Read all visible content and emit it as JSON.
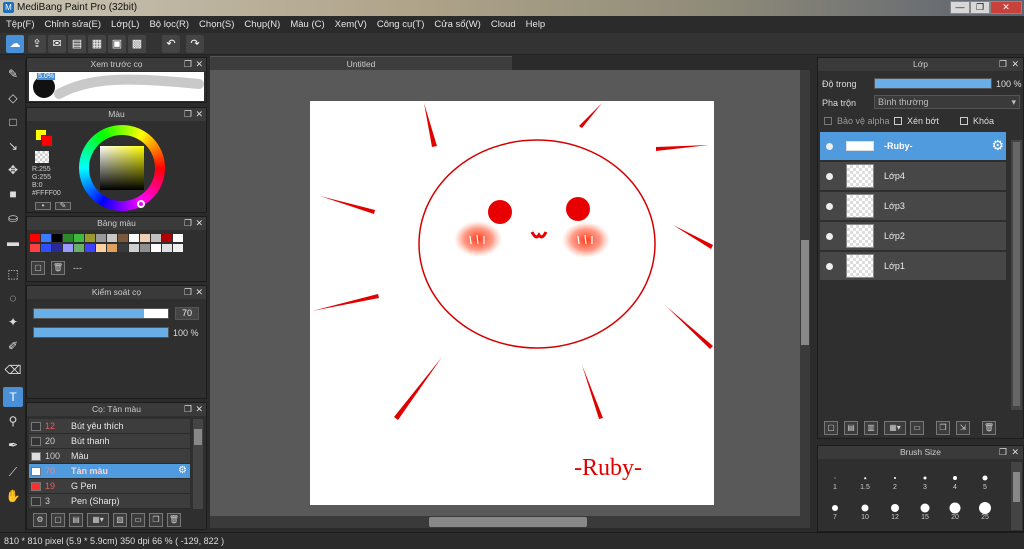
{
  "window": {
    "title": "MediBang Paint Pro (32bit)",
    "controls": [
      "—",
      "❐",
      "✕"
    ]
  },
  "menu": [
    "Tệp(F)",
    "Chỉnh sửa(E)",
    "Lớp(L)",
    "Bộ lọc(R)",
    "Chọn(S)",
    "Chụp(N)",
    "Màu (C)",
    "Xem(V)",
    "Công cụ(T)",
    "Cửa sổ(W)",
    "Cloud",
    "Help"
  ],
  "document": {
    "tab_title": "Untitled",
    "signature_text": "-Ruby-"
  },
  "brush_preview_panel": {
    "title": "Xem trước cọ",
    "size_label": "5.0%"
  },
  "color_panel": {
    "title": "Màu",
    "r": "R:255",
    "g": "G:255",
    "b": "B:0",
    "hex": "#FFFF00",
    "primary_color": "#ffff00",
    "secondary_color": "#ff0000"
  },
  "palette_panel": {
    "title": "Bảng màu",
    "extra_label": "---",
    "swatches": [
      "#ff0000",
      "#3d7cff",
      "#000000",
      "#2a8a2a",
      "#3dbb3d",
      "#9a9a2a",
      "#9a9a9a",
      "#c8c8c8",
      "#7a5a3a",
      "#ffffff",
      "#f0d0b0",
      "#c0c0c0",
      "#b00000",
      "#ffffff",
      "#ff4040",
      "#3050ff",
      "#2a2a9a",
      "#9a9aff",
      "#6ab06a",
      "#4040ff",
      "#ffd0a0",
      "#e0a060",
      "#3a3a3a",
      "#d0d0d0",
      "#909090",
      "#ffffff",
      "#e0e0e0",
      "#f0f0f0"
    ]
  },
  "brush_control_panel": {
    "title": "Kiểm soát cọ",
    "size_value": "70",
    "opacity_value": "100 %",
    "size_fraction": 0.82,
    "opacity_fraction": 1.0
  },
  "brush_list_panel": {
    "title": "Cọ: Tản màu",
    "items": [
      {
        "size": "12",
        "name": "Bút yêu thích",
        "color": "#333333",
        "selected": false
      },
      {
        "size": "20",
        "name": "Bút thanh",
        "color": "#333333",
        "selected": false
      },
      {
        "size": "100",
        "name": "Màu",
        "color": "#dddddd",
        "selected": false
      },
      {
        "size": "70",
        "name": "Tản màu",
        "color": "#ffffff",
        "selected": true
      },
      {
        "size": "19",
        "name": "G Pen",
        "color": "#ff3030",
        "selected": false
      },
      {
        "size": "3",
        "name": "Pen (Sharp)",
        "color": "#333333",
        "selected": false
      }
    ]
  },
  "layer_panel": {
    "title": "Lớp",
    "opacity_label": "Độ trong",
    "opacity_value": "100 %",
    "opacity_fraction": 1.0,
    "blend_label": "Pha trộn",
    "blend_value": "Bình thường",
    "protect_alpha": "Bảo vệ alpha",
    "clipping": "Xén bớt",
    "lock": "Khóa",
    "layers": [
      {
        "name": "-Ruby-",
        "selected": true
      },
      {
        "name": "Lớp4",
        "selected": false
      },
      {
        "name": "Lớp3",
        "selected": false
      },
      {
        "name": "Lớp2",
        "selected": false
      },
      {
        "name": "Lớp1",
        "selected": false
      }
    ]
  },
  "brush_size_panel": {
    "title": "Brush Size",
    "sizes": [
      "1",
      "1.5",
      "2",
      "3",
      "4",
      "5",
      "7",
      "10",
      "12",
      "15",
      "20",
      "25"
    ]
  },
  "status": {
    "text": "810 * 810 pixel   (5.9 * 5.9cm)   350 dpi   66 %   ( -129, 822 )"
  }
}
